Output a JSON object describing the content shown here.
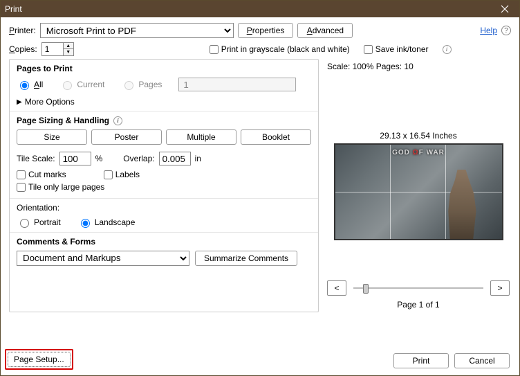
{
  "window_title": "Print",
  "header": {
    "printer_label": "Printer:",
    "printer_value": "Microsoft Print to PDF",
    "properties_label": "Properties",
    "advanced_label": "Advanced",
    "help_label": "Help",
    "copies_label": "Copies:",
    "copies_value": "1",
    "grayscale_label": "Print in grayscale (black and white)",
    "save_ink_label": "Save ink/toner"
  },
  "pages": {
    "section_title": "Pages to Print",
    "all_label": "All",
    "current_label": "Current",
    "pages_label": "Pages",
    "pages_value": "1",
    "more_options": "More Options"
  },
  "sizing": {
    "section_title": "Page Sizing & Handling",
    "tabs": {
      "size": "Size",
      "poster": "Poster",
      "multiple": "Multiple",
      "booklet": "Booklet"
    },
    "tile_scale_label": "Tile Scale:",
    "tile_scale_value": "100",
    "tile_scale_unit": "%",
    "overlap_label": "Overlap:",
    "overlap_value": "0.005",
    "overlap_unit": "in",
    "cut_marks": "Cut marks",
    "labels": "Labels",
    "tile_large": "Tile only large pages"
  },
  "orientation": {
    "section_title": "Orientation:",
    "portrait": "Portrait",
    "landscape": "Landscape"
  },
  "comments": {
    "section_title": "Comments & Forms",
    "selected": "Document and Markups",
    "summarize": "Summarize Comments"
  },
  "preview": {
    "info": "Scale: 100% Pages: 10",
    "dims": "29.13 x 16.54 Inches",
    "logo_pre": "GOD",
    "logo_mid": "Ω",
    "logo_post": "F WAR",
    "page_label": "Page 1 of 1"
  },
  "footer": {
    "page_setup": "Page Setup...",
    "print": "Print",
    "cancel": "Cancel"
  }
}
